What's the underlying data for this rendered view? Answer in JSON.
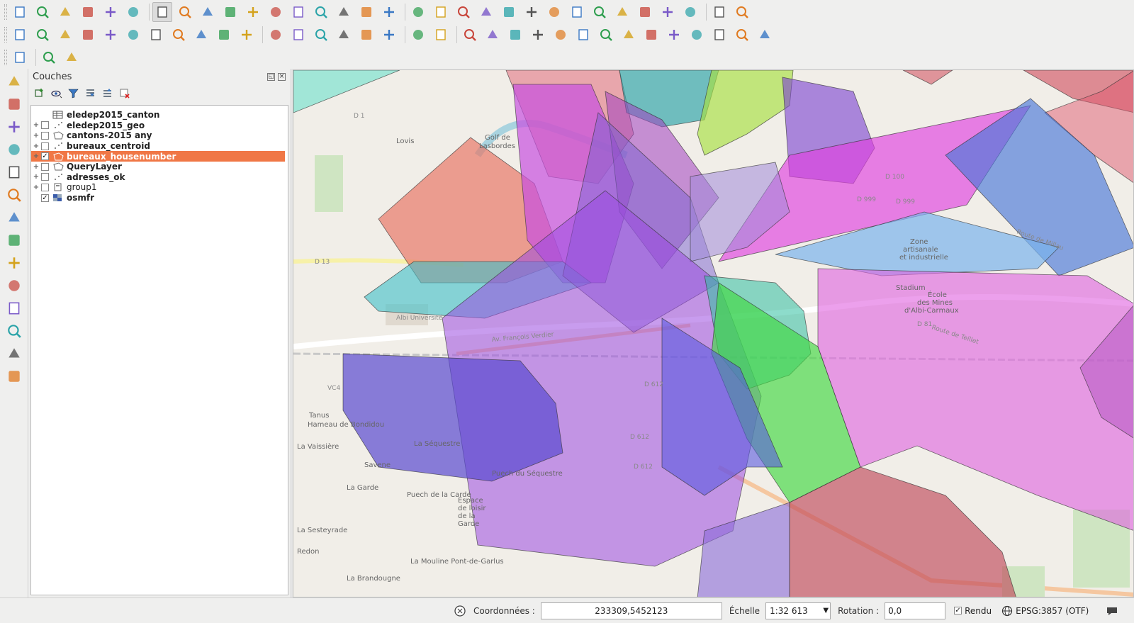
{
  "toolbar_row1_icons": [
    "new-project-icon",
    "open-project-icon",
    "save-project-icon",
    "save-as-icon",
    "new-print-composer-icon",
    "composer-manager-icon",
    "pan-icon",
    "pan-to-selection-icon",
    "zoom-in-icon",
    "zoom-out-icon",
    "zoom-native-icon",
    "zoom-full-icon",
    "zoom-to-selection-icon",
    "zoom-to-layer-icon",
    "zoom-last-icon",
    "zoom-next-icon",
    "refresh-icon",
    "identify-icon",
    "action-icon",
    "select-features-icon",
    "deselect-icon",
    "expression-select-icon",
    "attribute-table-icon",
    "field-calculator-icon",
    "statistics-icon",
    "measure-icon",
    "annotation-icon",
    "map-tips-icon",
    "bookmark-icon",
    "text-annotation-icon",
    "help-icon",
    "whats-this-icon"
  ],
  "toolbar_row2_icons": [
    "current-edits-icon",
    "toggle-editing-icon",
    "save-layer-edits-icon",
    "add-feature-icon",
    "move-feature-icon",
    "node-tool-icon",
    "delete-selected-icon",
    "cut-features-icon",
    "copy-features-icon",
    "paste-features-icon",
    "xy-tool-icon",
    "label-icon",
    "pin-labels-icon",
    "show-hide-labels-icon",
    "move-label-icon",
    "rotate-label-icon",
    "change-label-icon",
    "grass-icon",
    "csw-icon",
    "python-console-icon",
    "ae-icon",
    "cluster-icon",
    "raster-calc-icon",
    "raster-align-icon",
    "tools-icon",
    "network-icon",
    "binoculars-icon",
    "shape-icon",
    "edit-geometry-icon",
    "globe-icon",
    "svg-icon",
    "turtle-icon",
    "grid-icon"
  ],
  "toolbar_row3_icons": [
    "database-icon",
    "ban-icon",
    "geocode-icon"
  ],
  "left_tools_icons": [
    "add-vector-layer-icon",
    "add-raster-layer-icon",
    "add-postgis-icon",
    "add-spatialite-icon",
    "add-mssql-icon",
    "add-wms-icon",
    "add-wcs-icon",
    "add-wfs-icon",
    "add-delimited-text-icon",
    "add-virtual-layer-icon",
    "new-shapefile-icon",
    "new-spatialite-icon",
    "new-geopackage-icon",
    "new-temporary-icon"
  ],
  "panel": {
    "title": "Couches",
    "layers": [
      {
        "name": "eledep2015_canton",
        "expander": "",
        "checked": null,
        "selected": false,
        "bold": true,
        "icon": "table-icon"
      },
      {
        "name": "eledep2015_geo",
        "expander": "+",
        "checked": false,
        "selected": false,
        "bold": true,
        "icon": "point-layer-icon"
      },
      {
        "name": "cantons-2015 any",
        "expander": "+",
        "checked": false,
        "selected": false,
        "bold": true,
        "icon": "polygon-layer-icon"
      },
      {
        "name": "bureaux_centroid",
        "expander": "+",
        "checked": false,
        "selected": false,
        "bold": true,
        "icon": "point-layer-icon"
      },
      {
        "name": "bureaux_housenumber",
        "expander": "+",
        "checked": true,
        "selected": true,
        "bold": true,
        "icon": "polygon-layer-icon"
      },
      {
        "name": "QueryLayer",
        "expander": "+",
        "checked": false,
        "selected": false,
        "bold": true,
        "icon": "polygon-layer-icon"
      },
      {
        "name": "adresses_ok",
        "expander": "+",
        "checked": false,
        "selected": false,
        "bold": true,
        "icon": "point-layer-icon"
      },
      {
        "name": "group1",
        "expander": "+",
        "checked": false,
        "selected": false,
        "bold": false,
        "icon": "group-icon"
      },
      {
        "name": "osmfr",
        "expander": "",
        "checked": true,
        "selected": false,
        "bold": true,
        "icon": "raster-layer-icon"
      }
    ]
  },
  "map_labels": {
    "golf": "Golf de\nLasbordes",
    "stadium": "Stadium",
    "ecole": "École\ndes Mines\nd'Albi-Carmaux",
    "zone": "Zone\nartisanale\net industrielle",
    "tanus": "Tanus",
    "hameau": "Hameau de Bondidou",
    "la_vaissiere": "La Vaissière",
    "la_sequestre": "La Séquestre",
    "saveme": "Savene",
    "la_garde": "La Garde",
    "puech_carde": "Puech de la Carde",
    "puech_sequestre": "Puech du Séquestre",
    "espace": "Espace\nde loisir\nde la\nGarde",
    "la_sesteyrade": "La Sesteyrade",
    "redon": "Redon",
    "la_mouline": "La Mouline Pont-de-Garlus",
    "la_brandougne": "La Brandougne",
    "route_millau": "Route de Millau",
    "route_teillet": "Route de Teillet",
    "av_verdier": "Av. François Verdier",
    "albi_univ": "Albi Université",
    "lovis": "Lovis",
    "d1": "D 1",
    "d13": "D 13",
    "d100": "D 100",
    "d999a": "D 999",
    "d999b": "D 999",
    "d81": "D 81",
    "d612a": "D 612",
    "d612b": "D 612",
    "d612c": "D 612",
    "vc4": "VC4"
  },
  "status": {
    "coord_label": "Coordonnées :",
    "coord_value": "233309,5452123",
    "scale_label": "Échelle",
    "scale_value": "1:32 613",
    "rotation_label": "Rotation :",
    "rotation_value": "0,0",
    "render_label": "Rendu",
    "render_checked": "✓",
    "crs": "EPSG:3857 (OTF)"
  },
  "colors": {
    "selected_row": "#f07746",
    "map_bg": "#f1eee8"
  }
}
